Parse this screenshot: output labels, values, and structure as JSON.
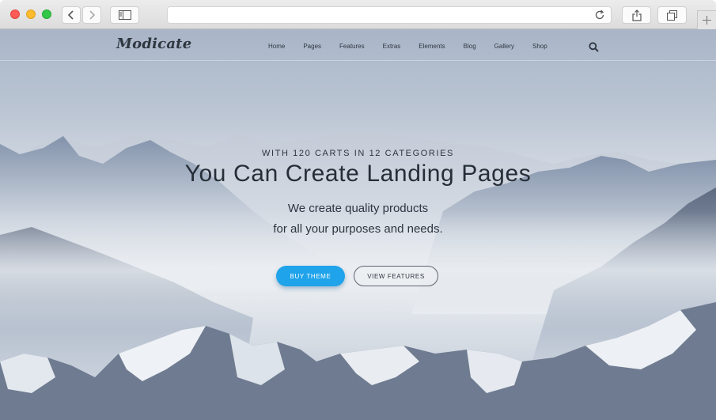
{
  "browser": {
    "toolbar_icons": [
      "back-icon",
      "forward-icon",
      "sidebar-icon",
      "reload-icon",
      "share-icon",
      "tabs-icon",
      "plus-icon"
    ],
    "address_value": ""
  },
  "site": {
    "logo": "Modicate",
    "nav": [
      "Home",
      "Pages",
      "Features",
      "Extras",
      "Elements",
      "Blog",
      "Gallery",
      "Shop"
    ],
    "search_icon": "search-icon"
  },
  "hero": {
    "eyebrow": "WITH 120 CARTS IN 12 CATEGORIES",
    "headline": "You Can Create Landing Pages",
    "subline1": "We create quality products",
    "subline2": "for all your purposes and needs.",
    "primary_button": "BUY THEME",
    "secondary_button": "VIEW FEATURES"
  },
  "colors": {
    "accent": "#1fa3ea",
    "text_dark": "#262e38"
  }
}
